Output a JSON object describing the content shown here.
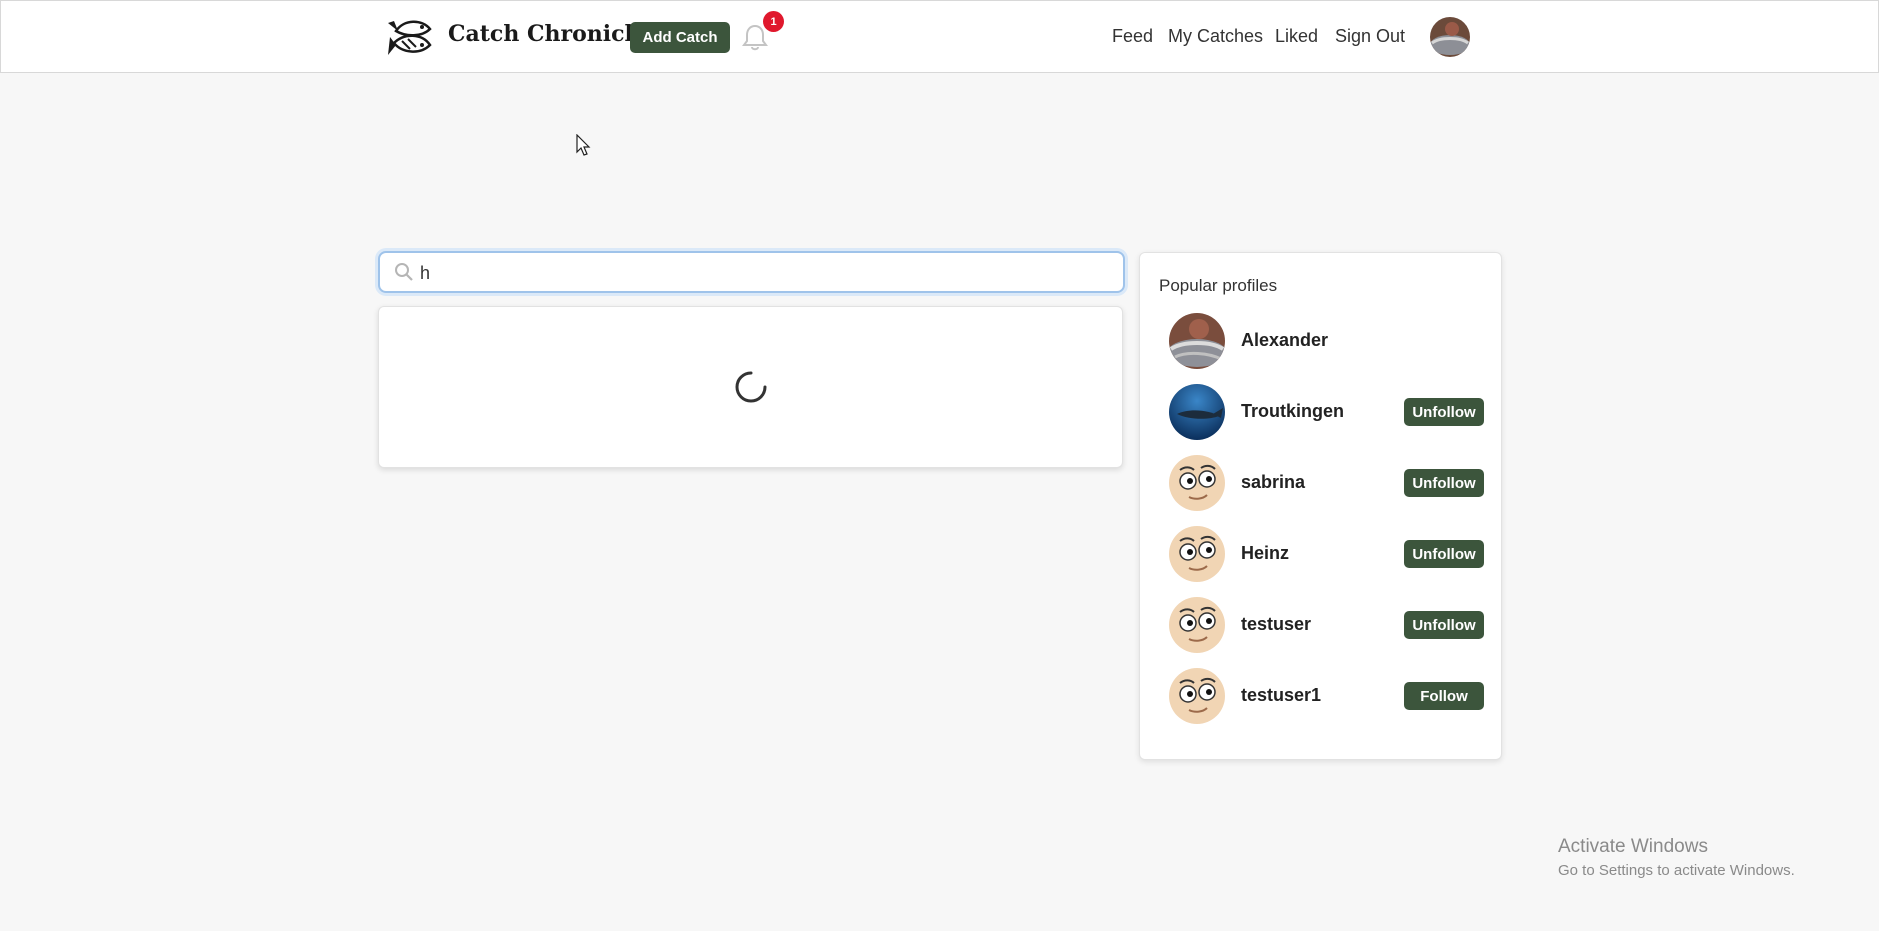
{
  "header": {
    "brand": "Catch Chronicle",
    "add_catch_label": "Add Catch",
    "notification_count": "1",
    "nav": {
      "feed": "Feed",
      "my_catches": "My Catches",
      "liked": "Liked",
      "sign_out": "Sign Out"
    }
  },
  "search": {
    "value": "h",
    "status": "loading"
  },
  "popular_profiles": {
    "title": "Popular profiles",
    "items": [
      {
        "name": "Alexander",
        "avatar": "photo-fish-avatar",
        "button": ""
      },
      {
        "name": "Troutkingen",
        "avatar": "photo-underwater-avatar",
        "button": "Unfollow"
      },
      {
        "name": "sabrina",
        "avatar": "cartoon-face-avatar",
        "button": "Unfollow"
      },
      {
        "name": "Heinz",
        "avatar": "cartoon-face-avatar",
        "button": "Unfollow"
      },
      {
        "name": "testuser",
        "avatar": "cartoon-face-avatar",
        "button": "Unfollow"
      },
      {
        "name": "testuser1",
        "avatar": "cartoon-face-avatar",
        "button": "Follow"
      }
    ]
  },
  "watermark": {
    "title": "Activate Windows",
    "subtitle": "Go to Settings to activate Windows."
  },
  "colors": {
    "accent": "#3c553c",
    "badge": "#e0182d",
    "focus_ring": "#9fc3ea",
    "background": "#f7f7f7"
  }
}
